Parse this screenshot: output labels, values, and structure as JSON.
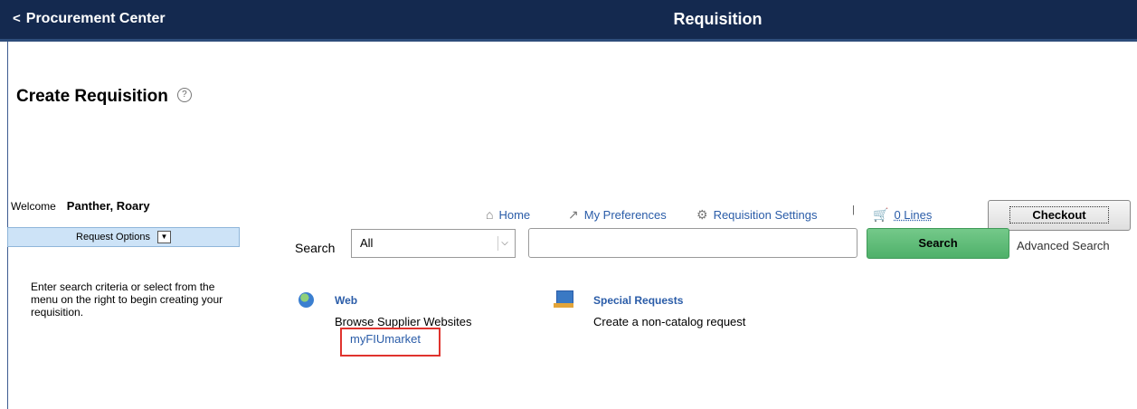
{
  "header": {
    "back_label": "Procurement Center",
    "title": "Requisition",
    "background_color": "#14294f"
  },
  "page": {
    "title": "Create Requisition"
  },
  "welcome": {
    "label": "Welcome",
    "user_name": "Panther, Roary"
  },
  "nav": {
    "home": "Home",
    "preferences": "My Preferences",
    "settings": "Requisition Settings",
    "separator": "|",
    "cart_count": "0 Lines",
    "checkout": "Checkout"
  },
  "request_options": {
    "label": "Request Options"
  },
  "search": {
    "label": "Search",
    "category_value": "All",
    "query_value": "",
    "button": "Search",
    "advanced": "Advanced Search",
    "button_color": "#5cbb76"
  },
  "instructions": "Enter search criteria or select from the menu on the right to begin creating your requisition.",
  "sources": {
    "web": {
      "title": "Web",
      "description": "Browse Supplier Websites",
      "link": "myFIUmarket"
    },
    "special": {
      "title": "Special Requests",
      "description": "Create a non-catalog request"
    }
  },
  "icons": [
    "back-chevron-icon",
    "help-icon",
    "home-icon",
    "wand-icon",
    "gears-icon",
    "cart-icon",
    "dropdown-arrow-icon",
    "chevron-down-icon",
    "globe-icon",
    "special-request-icon"
  ],
  "highlight_color": "#e0332e"
}
